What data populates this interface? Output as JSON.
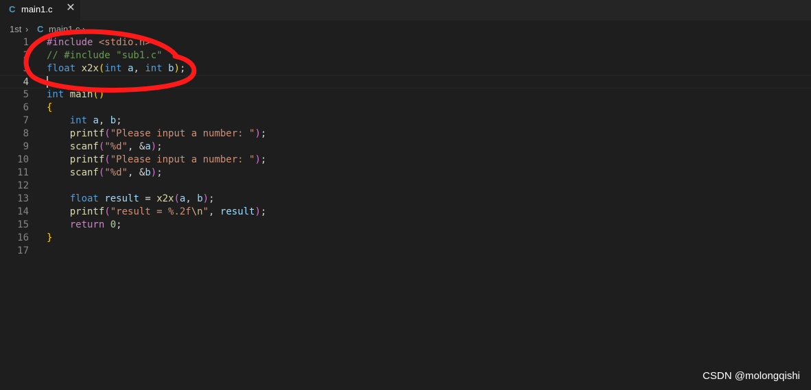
{
  "tab": {
    "lang_icon": "C",
    "filename": "main1.c",
    "close_glyph": "✕"
  },
  "breadcrumb": {
    "folder": "1st",
    "sep": "›",
    "lang_icon": "C",
    "file": "main1.c",
    "more": "..."
  },
  "code_lines": [
    {
      "n": "1",
      "tokens": [
        [
          "pre",
          "#include "
        ],
        [
          "str",
          "<stdio.h>"
        ]
      ]
    },
    {
      "n": "2",
      "tokens": [
        [
          "cmt",
          "// #include \"sub1.c\""
        ]
      ]
    },
    {
      "n": "3",
      "tokens": [
        [
          "kw",
          "float"
        ],
        [
          "p",
          " "
        ],
        [
          "fn",
          "x2x"
        ],
        [
          "b1",
          "("
        ],
        [
          "kw",
          "int"
        ],
        [
          "p",
          " "
        ],
        [
          "var",
          "a"
        ],
        [
          "p",
          ", "
        ],
        [
          "kw",
          "int"
        ],
        [
          "p",
          " "
        ],
        [
          "var",
          "b"
        ],
        [
          "b1",
          ")"
        ],
        [
          "p",
          ";"
        ]
      ]
    },
    {
      "n": "4",
      "tokens": []
    },
    {
      "n": "5",
      "tokens": [
        [
          "kw",
          "int"
        ],
        [
          "p",
          " "
        ],
        [
          "fn",
          "main"
        ],
        [
          "b1",
          "()"
        ]
      ]
    },
    {
      "n": "6",
      "tokens": [
        [
          "b1",
          "{"
        ]
      ]
    },
    {
      "n": "7",
      "tokens": [
        [
          "p",
          "    "
        ],
        [
          "kw",
          "int"
        ],
        [
          "p",
          " "
        ],
        [
          "var",
          "a"
        ],
        [
          "p",
          ", "
        ],
        [
          "var",
          "b"
        ],
        [
          "p",
          ";"
        ]
      ]
    },
    {
      "n": "8",
      "tokens": [
        [
          "p",
          "    "
        ],
        [
          "fn",
          "printf"
        ],
        [
          "b2",
          "("
        ],
        [
          "str",
          "\"Please input a number: \""
        ],
        [
          "b2",
          ")"
        ],
        [
          "p",
          ";"
        ]
      ]
    },
    {
      "n": "9",
      "tokens": [
        [
          "p",
          "    "
        ],
        [
          "fn",
          "scanf"
        ],
        [
          "b2",
          "("
        ],
        [
          "str",
          "\"%d\""
        ],
        [
          "p",
          ", &"
        ],
        [
          "var",
          "a"
        ],
        [
          "b2",
          ")"
        ],
        [
          "p",
          ";"
        ]
      ]
    },
    {
      "n": "10",
      "tokens": [
        [
          "p",
          "    "
        ],
        [
          "fn",
          "printf"
        ],
        [
          "b2",
          "("
        ],
        [
          "str",
          "\"Please input a number: \""
        ],
        [
          "b2",
          ")"
        ],
        [
          "p",
          ";"
        ]
      ]
    },
    {
      "n": "11",
      "tokens": [
        [
          "p",
          "    "
        ],
        [
          "fn",
          "scanf"
        ],
        [
          "b2",
          "("
        ],
        [
          "str",
          "\"%d\""
        ],
        [
          "p",
          ", &"
        ],
        [
          "var",
          "b"
        ],
        [
          "b2",
          ")"
        ],
        [
          "p",
          ";"
        ]
      ]
    },
    {
      "n": "12",
      "tokens": []
    },
    {
      "n": "13",
      "tokens": [
        [
          "p",
          "    "
        ],
        [
          "kw",
          "float"
        ],
        [
          "p",
          " "
        ],
        [
          "var",
          "result"
        ],
        [
          "p",
          " = "
        ],
        [
          "fn",
          "x2x"
        ],
        [
          "b2",
          "("
        ],
        [
          "var",
          "a"
        ],
        [
          "p",
          ", "
        ],
        [
          "var",
          "b"
        ],
        [
          "b2",
          ")"
        ],
        [
          "p",
          ";"
        ]
      ]
    },
    {
      "n": "14",
      "tokens": [
        [
          "p",
          "    "
        ],
        [
          "fn",
          "printf"
        ],
        [
          "b2",
          "("
        ],
        [
          "str",
          "\"result = %.2f"
        ],
        [
          "esc",
          "\\n"
        ],
        [
          "str",
          "\""
        ],
        [
          "p",
          ", "
        ],
        [
          "var",
          "result"
        ],
        [
          "b2",
          ")"
        ],
        [
          "p",
          ";"
        ]
      ]
    },
    {
      "n": "15",
      "tokens": [
        [
          "p",
          "    "
        ],
        [
          "ctrl",
          "return"
        ],
        [
          "p",
          " "
        ],
        [
          "num",
          "0"
        ],
        [
          "p",
          ";"
        ]
      ]
    },
    {
      "n": "16",
      "tokens": [
        [
          "b1",
          "}"
        ]
      ]
    },
    {
      "n": "17",
      "tokens": []
    }
  ],
  "current_line": "4",
  "annotation_color": "#ff1a1a",
  "watermark": "CSDN @molongqishi"
}
